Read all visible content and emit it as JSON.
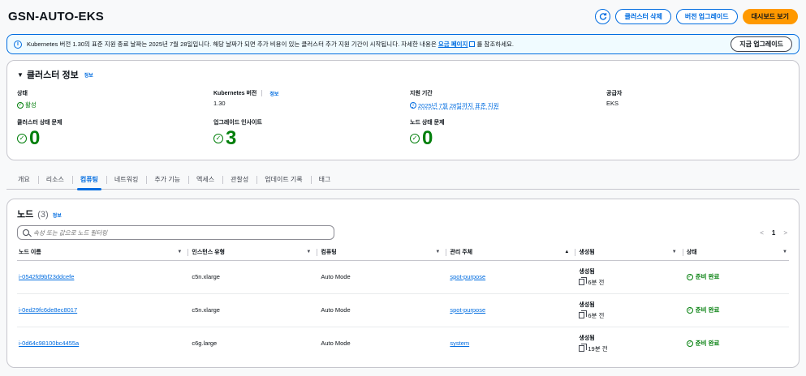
{
  "header": {
    "title": "GSN-AUTO-EKS",
    "refresh_icon": "refresh-icon",
    "delete_label": "클러스터 삭제",
    "upgrade_label": "버전 업그레이드",
    "dashboard_label": "대시보드 보기"
  },
  "banner": {
    "icon": "info-icon",
    "text_before": "Kubernetes 버전 1.30의 표준 지원 종료 날짜는 2025년 7월 28일입니다. 해당 날짜가 되면 추가 비용이 있는 클러스터 추가 지원 기간이 시작됩니다. 자세한 내용은 ",
    "link_text": "요금 페이지",
    "text_after": "를 참조하세요.",
    "button_label": "지금 업그레이드"
  },
  "cluster_info": {
    "title": "클러스터 정보",
    "info_label": "정보",
    "status_label": "상태",
    "status_value": "활성",
    "k8s_label": "Kubernetes 버전",
    "k8s_info": "정보",
    "k8s_value": "1.30",
    "support_label": "지원 기간",
    "support_value": "2025년 7월 28일까지 표준 지원",
    "provider_label": "공급자",
    "provider_value": "EKS",
    "health_label": "클러스터 상태 문제",
    "health_count": "0",
    "insights_label": "업그레이드 인사이트",
    "insights_count": "3",
    "node_health_label": "노드 상태 문제",
    "node_health_count": "0"
  },
  "tabs": [
    "개요",
    "리소스",
    "컴퓨팅",
    "네트워킹",
    "추가 기능",
    "액세스",
    "관찰성",
    "업데이트 기록",
    "태그"
  ],
  "active_tab": 2,
  "nodes": {
    "title": "노드",
    "count": "(3)",
    "info_label": "정보",
    "search_placeholder": "속성 또는 값으로 노드 필터링",
    "pager": {
      "prev": "<",
      "page": "1",
      "next": ">"
    },
    "columns": [
      "노드 이름",
      "인스턴스 유형",
      "컴퓨팅",
      "관리 주체",
      "생성됨",
      "상태"
    ],
    "rows": [
      {
        "name": "i-0542fd9bf23ddcefe",
        "instance": "c5n.xlarge",
        "compute": "Auto Mode",
        "managed": "spot-purpose",
        "created_label": "생성됨",
        "created_time": "6분 전",
        "status": "준비 완료"
      },
      {
        "name": "i-0ed29fc6de8ec8017",
        "instance": "c5n.xlarge",
        "compute": "Auto Mode",
        "managed": "spot-purpose",
        "created_label": "생성됨",
        "created_time": "6분 전",
        "status": "준비 완료"
      },
      {
        "name": "i-0d64c98100bc4455a",
        "instance": "c6g.large",
        "compute": "Auto Mode",
        "managed": "system",
        "created_label": "생성됨",
        "created_time": "19분 전",
        "status": "준비 완료"
      }
    ]
  },
  "colors": {
    "accent": "#006ce0",
    "primary": "#ff9900",
    "success": "#037f0c"
  }
}
